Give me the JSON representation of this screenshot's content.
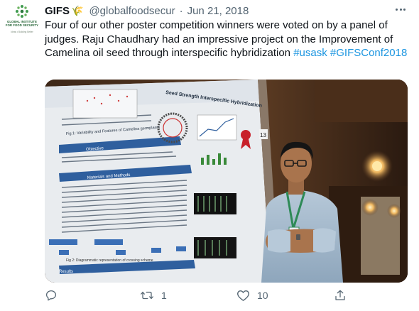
{
  "tweet": {
    "author": {
      "display_name": "GIFS",
      "name_emoji": "🌾",
      "handle": "@globalfoodsecur",
      "avatar_text": "GLOBAL INSTITUTE FOR FOOD SECURITY",
      "avatar_subtext": "Ideas • Building Better"
    },
    "separator": "·",
    "date": "Jun 21, 2018",
    "body_text": "Four of our other poster competition winners were voted on by a panel of judges. Raju Chaudhary had an impressive project on the Improvement of Camelina oil seed through interspecific hybridization ",
    "hashtags": [
      "#usask",
      "#GIFSConf2018"
    ],
    "hashtag_separator": " ",
    "actions": {
      "reply": {
        "icon": "reply-icon",
        "count": ""
      },
      "retweet": {
        "icon": "retweet-icon",
        "count": "1"
      },
      "like": {
        "icon": "heart-icon",
        "count": "10"
      },
      "share": {
        "icon": "share-icon",
        "count": ""
      }
    }
  },
  "photo": {
    "description_icon": "photo-image",
    "poster": {
      "title_fragment": "Seed Strength Interspecific Hybridization",
      "section_1": "Fig 1: Variability and Features of Camelina germplasm",
      "section_2": "Materials and Methods",
      "section_3": "Objective",
      "section_4": "Results",
      "fig_caption": "Fig 2: Diagrammatic representation of crossing scheme",
      "panel_number": "13"
    }
  },
  "colors": {
    "text": "#0f1419",
    "muted": "#536471",
    "link": "#1b95e0",
    "brand_green": "#1d5f2f"
  }
}
